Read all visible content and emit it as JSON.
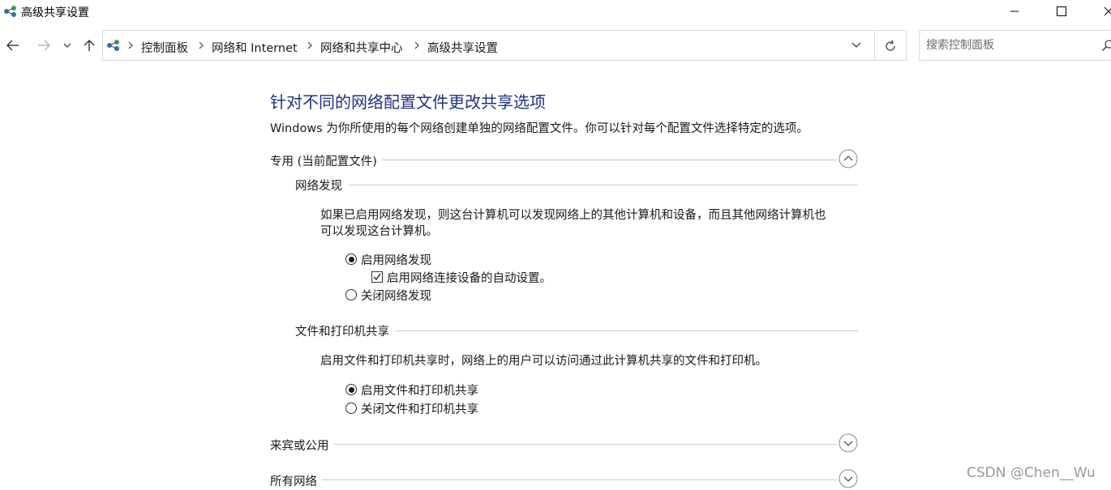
{
  "window": {
    "title": "高级共享设置",
    "app_icon": "network-sharing-icon",
    "controls": [
      "minimize-icon",
      "maximize-icon",
      "close-icon"
    ]
  },
  "nav": {
    "back_icon": "arrow-left-icon",
    "forward_icon": "arrow-right-icon",
    "recent_icon": "chevron-down-icon",
    "up_icon": "arrow-up-icon"
  },
  "address_bar": {
    "icon": "network-sharing-icon",
    "breadcrumbs": [
      "控制面板",
      "网络和 Internet",
      "网络和共享中心",
      "高级共享设置"
    ],
    "separator_icon": "chevron-right-icon",
    "dropdown_icon": "chevron-down-icon",
    "refresh_icon": "refresh-icon"
  },
  "search": {
    "placeholder": "搜索控制面板",
    "value": "",
    "icon": "search-icon"
  },
  "main": {
    "heading": "针对不同的网络配置文件更改共享选项",
    "intro": "Windows 为你所使用的每个网络创建单独的网络配置文件。你可以针对每个配置文件选择特定的选项。",
    "profiles": [
      {
        "label": "专用 (当前配置文件)",
        "expanded": true,
        "toggle_icon": "chevron-up-circle-icon",
        "sections": [
          {
            "title": "网络发现",
            "description_lines": [
              "如果已启用网络发现，则这台计算机可以发现网络上的其他计算机和设备，而且其他网络计算机也",
              "可以发现这台计算机。"
            ],
            "options": {
              "on": {
                "label": "启用网络发现",
                "checked": true
              },
              "auto_setup": {
                "label": "启用网络连接设备的自动设置。",
                "checked": true
              },
              "off": {
                "label": "关闭网络发现",
                "checked": false
              }
            }
          },
          {
            "title": "文件和打印机共享",
            "description_lines": [
              "启用文件和打印机共享时，网络上的用户可以访问通过此计算机共享的文件和打印机。"
            ],
            "options": {
              "on": {
                "label": "启用文件和打印机共享",
                "checked": true
              },
              "off": {
                "label": "关闭文件和打印机共享",
                "checked": false
              }
            }
          }
        ]
      },
      {
        "label": "来宾或公用",
        "expanded": false,
        "toggle_icon": "chevron-down-circle-icon"
      },
      {
        "label": "所有网络",
        "expanded": false,
        "toggle_icon": "chevron-down-circle-icon"
      }
    ]
  },
  "watermark": "CSDN @Chen__Wu",
  "colors": {
    "heading": "#1e3287",
    "border": "#d9d9d9",
    "divider": "#c9c9c9",
    "watermark": "#9a9a9a"
  }
}
